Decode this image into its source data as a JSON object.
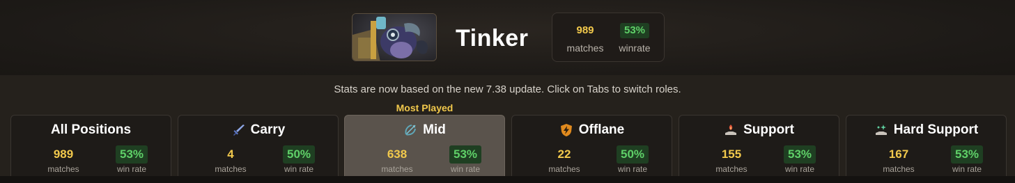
{
  "hero": {
    "name": "Tinker",
    "portrait_icon": "tinker-portrait",
    "summary": {
      "matches_value": "989",
      "matches_label": "matches",
      "winrate_value": "53%",
      "winrate_label": "winrate"
    }
  },
  "notice": "Stats are now based on the new 7.38 update. Click on Tabs to switch roles.",
  "most_played_label": "Most Played",
  "colors": {
    "accent_yellow": "#f2c94c",
    "win_green": "#5fd068",
    "active_tab": "#5a534c"
  },
  "tabs": [
    {
      "title": "All Positions",
      "icon": "",
      "matches": "989",
      "matches_label": "matches",
      "winrate": "53%",
      "winrate_label": "win rate",
      "active": false
    },
    {
      "title": "Carry",
      "icon": "sword-icon",
      "matches": "4",
      "matches_label": "matches",
      "winrate": "50%",
      "winrate_label": "win rate",
      "active": false
    },
    {
      "title": "Mid",
      "icon": "bow-icon",
      "matches": "638",
      "matches_label": "matches",
      "winrate": "53%",
      "winrate_label": "win rate",
      "active": true
    },
    {
      "title": "Offlane",
      "icon": "lightning-shield-icon",
      "matches": "22",
      "matches_label": "matches",
      "winrate": "50%",
      "winrate_label": "win rate",
      "active": false
    },
    {
      "title": "Support",
      "icon": "hand-flame-icon",
      "matches": "155",
      "matches_label": "matches",
      "winrate": "53%",
      "winrate_label": "win rate",
      "active": false
    },
    {
      "title": "Hard Support",
      "icon": "hand-sparkle-icon",
      "matches": "167",
      "matches_label": "matches",
      "winrate": "53%",
      "winrate_label": "win rate",
      "active": false
    }
  ]
}
